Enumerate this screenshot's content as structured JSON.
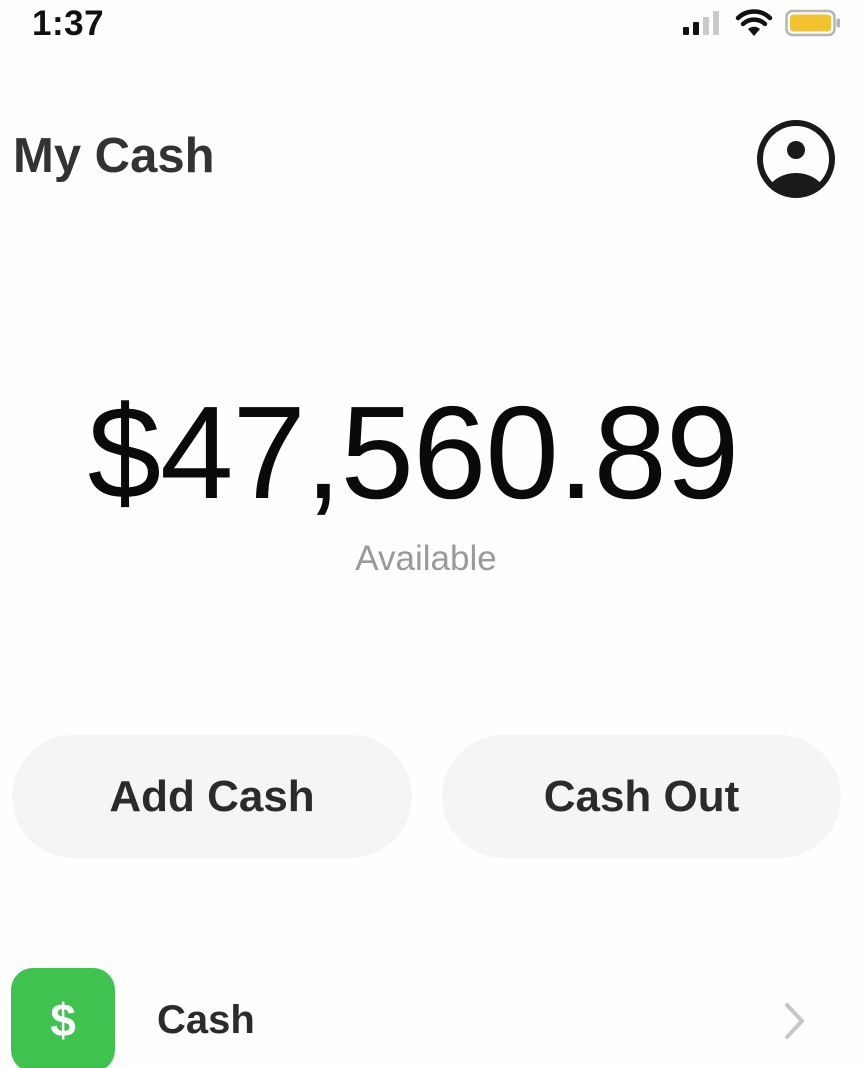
{
  "status_bar": {
    "time": "1:37",
    "icons": [
      "signal-icon",
      "wifi-icon",
      "battery-icon"
    ],
    "battery_color": "#f2c230"
  },
  "header": {
    "title": "My Cash",
    "profile_icon": "profile-icon"
  },
  "balance": {
    "amount": "$47,560.89",
    "caption": "Available"
  },
  "actions": {
    "add_cash_label": "Add Cash",
    "cash_out_label": "Cash Out"
  },
  "accounts": [
    {
      "label": "Cash",
      "icon_symbol": "$",
      "icon_color": "#3fc24f",
      "chevron_icon": "chevron-right-icon"
    }
  ]
}
